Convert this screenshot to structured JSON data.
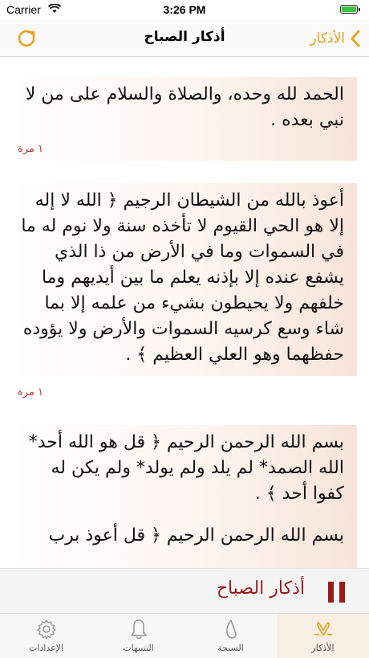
{
  "status_bar": {
    "carrier": "Carrier",
    "time": "3:26 PM",
    "battery_level": 1.0
  },
  "nav": {
    "title": "أذكار الصباح",
    "back_label": "الأذكار",
    "refresh_icon": "refresh-icon",
    "accent_color": "#e9a31c"
  },
  "cards": [
    {
      "text": "الحمد لله وحده، والصلاة والسلام على من لا نبي بعده .",
      "count": "١ مرة"
    },
    {
      "text": "أعوذ بالله من الشيطان الرجيم ﴿ الله لا إله إلا هو الحي القيوم لا تأخذه سنة ولا نوم له ما في السموات وما في الأرض من ذا الذي يشفع عنده إلا بإذنه يعلم ما بين أيديهم وما خلفهم ولا يحيطون بشيء من علمه إلا بما شاء وسع كرسيه السموات والأرض ولا يؤوده حفظهما وهو العلي العظيم ﴾ .",
      "count": "١ مرة"
    },
    {
      "paragraphs": [
        "بسم الله الرحمن الرحيم ﴿ قل هو الله أحد* الله الصمد* لم يلد ولم يولد* ولم يكن له كفوا أحد ﴾ .",
        "بسم الله الرحمن الرحيم ﴿ قل أعوذ برب"
      ]
    }
  ],
  "player": {
    "title": "أذكار الصباح",
    "color": "#9b1b1b"
  },
  "tabs": [
    {
      "label": "الأذكار",
      "icon": "praying-hands-icon",
      "active": true
    },
    {
      "label": "السبحة",
      "icon": "prayer-beads-icon",
      "active": false
    },
    {
      "label": "التنبيهات",
      "icon": "bell-icon",
      "active": false
    },
    {
      "label": "الإعدادات",
      "icon": "gear-icon",
      "active": false
    }
  ]
}
